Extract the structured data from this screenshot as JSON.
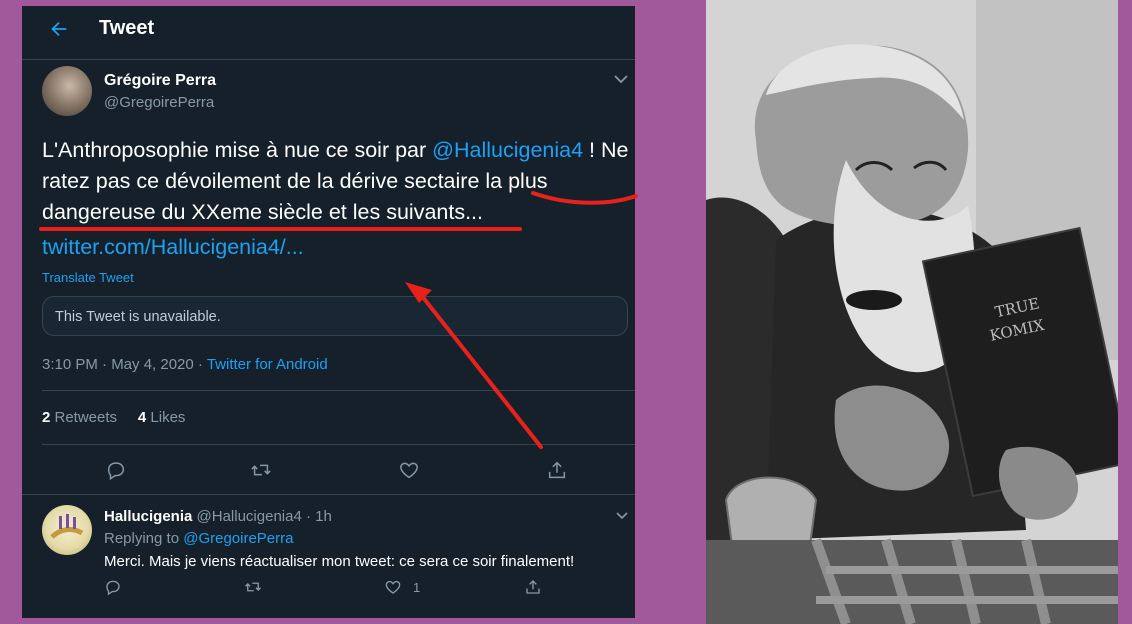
{
  "header": {
    "title": "Tweet"
  },
  "tweet": {
    "author_name": "Grégoire Perra",
    "author_handle": "@GregoirePerra",
    "text_part1": "L'Anthroposophie mise à nue ce soir par ",
    "text_mention": "@Hallucigenia4",
    "text_part2": " ! Ne ratez pas ce dévoilement de la dérive sectaire la plus dangereuse du XXeme siècle et les suivants...",
    "link": "twitter.com/Hallucigenia4/...",
    "translate": "Translate Tweet",
    "quoted_unavailable": "This Tweet is unavailable.",
    "time_date": "3:10 PM · May 4, 2020 · ",
    "source": "Twitter for Android",
    "retweets_count": "2",
    "retweets_label": " Retweets",
    "likes_count": "4",
    "likes_label": " Likes"
  },
  "reply": {
    "name": "Hallucigenia",
    "handle_time": " @Hallucigenia4 · 1h",
    "replying_prefix": "Replying to ",
    "replying_to": "@GregoirePerra",
    "text": "Merci. Mais je viens réactualiser mon tweet: ce sera ce soir finalement!",
    "like_count": "1"
  },
  "photo": {
    "book_title_line1": "TRUE",
    "book_title_line2": "KOMIX"
  },
  "colors": {
    "background": "#a1599b",
    "panel": "#15202b",
    "accent": "#1da1f2",
    "annotation": "#e8221b"
  },
  "icons": [
    "back-arrow-icon",
    "chevron-down-icon",
    "reply-icon",
    "retweet-icon",
    "like-icon",
    "share-icon"
  ]
}
